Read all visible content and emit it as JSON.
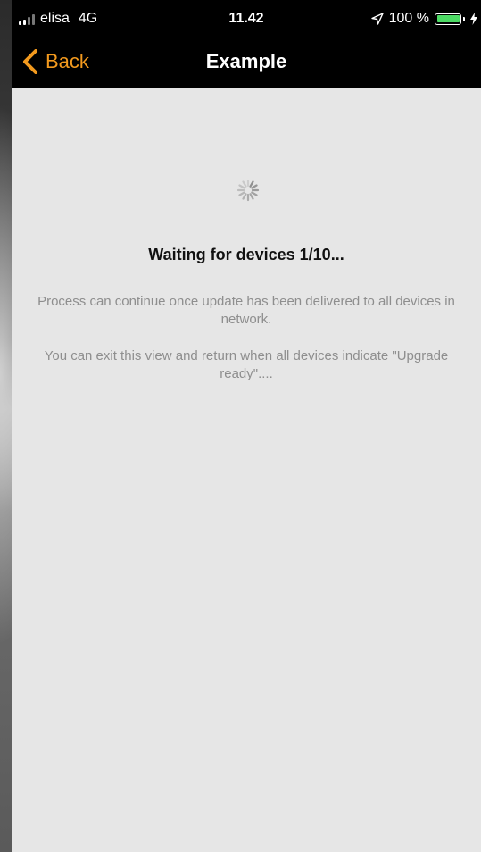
{
  "status_bar": {
    "carrier": "elisa",
    "network": "4G",
    "time": "11.42",
    "battery_percent": "100 %",
    "battery_level": 1.0,
    "signal_bars_filled": 2,
    "signal_bars_total": 4,
    "icons": [
      "signal-icon",
      "location-arrow-icon",
      "battery-icon",
      "charging-bolt-icon"
    ],
    "battery_color": "#4cd964"
  },
  "nav": {
    "back_label": "Back",
    "title": "Example",
    "accent_color": "#f39a1e"
  },
  "content": {
    "title": "Waiting for devices 1/10...",
    "message_1": "Process can continue once update has been delivered to all devices in network.",
    "message_2": "You can exit this view and return when all devices indicate \"Upgrade ready\"...."
  }
}
